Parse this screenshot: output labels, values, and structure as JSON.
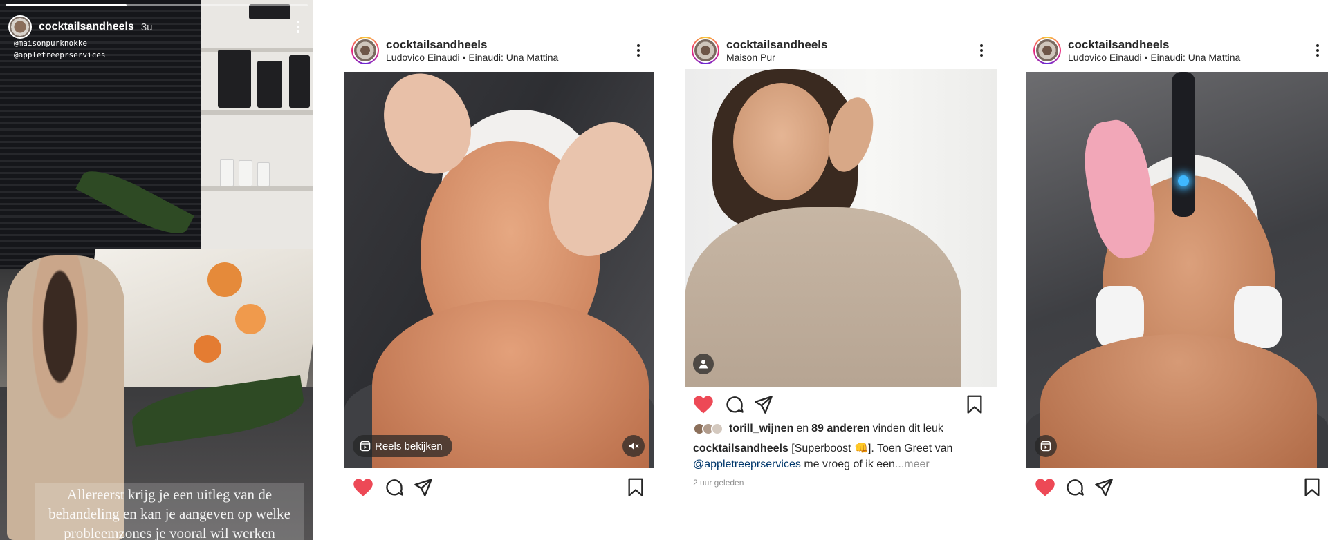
{
  "story": {
    "username": "cocktailsandheels",
    "time": "3u",
    "mentions": [
      "@maisonpurknokke",
      "@appletreeprservices"
    ],
    "caption_lines": [
      "Allereerst krijg je een uitleg van de",
      "behandeling en kan je aangeven op welke",
      "probleemzones je vooral wil werken"
    ]
  },
  "posts": [
    {
      "username": "cocktailsandheels",
      "subtitle": "Ludovico Einaudi • Einaudi: Una Mattina",
      "reels_label": "Reels bekijken"
    },
    {
      "username": "cocktailsandheels",
      "subtitle": "Maison Pur",
      "liked_by_user": "torill_wijnen",
      "liked_conjunction": "en",
      "liked_others": "89 anderen",
      "liked_suffix": "vinden dit leuk",
      "caption_user": "cocktailsandheels",
      "caption_text": "[Superboost 👊]. Toen Greet van",
      "caption_mention": "@appletreeprservices",
      "caption_rest": "me vroeg of ik een",
      "caption_more": "...meer",
      "timestamp": "2 uur geleden"
    },
    {
      "username": "cocktailsandheels",
      "subtitle": "Ludovico Einaudi • Einaudi: Una Mattina"
    }
  ],
  "colors": {
    "like_red": "#ed4956",
    "text": "#262626",
    "muted": "#8e8e8e",
    "link": "#00376b"
  },
  "icons": [
    "heart-icon",
    "comment-icon",
    "share-icon",
    "bookmark-icon",
    "more-icon",
    "reels-icon",
    "mute-icon",
    "user-tag-icon"
  ]
}
